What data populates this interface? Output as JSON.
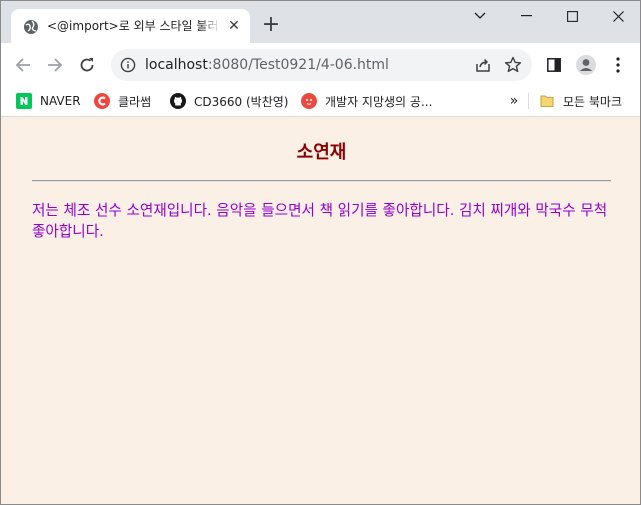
{
  "tab": {
    "title": "<@import>로 외부 스타일 불러",
    "close_glyph": "✕",
    "new_tab_glyph": "+"
  },
  "omnibox": {
    "host": "localhost",
    "path": ":8080/Test0921/4-06.html"
  },
  "bookmarks": {
    "items": [
      {
        "label": "NAVER",
        "icon": "naver-icon"
      },
      {
        "label": "클라썸",
        "icon": "classum-icon"
      },
      {
        "label": "CD3660 (박찬영)",
        "icon": "github-icon"
      },
      {
        "label": "개발자 지망생의 공...",
        "icon": "ghost-icon"
      }
    ],
    "more_glyph": "»",
    "all_bookmarks": "모든 북마크"
  },
  "page": {
    "heading": "소연재",
    "paragraph": "저는 체조 선수 소연재입니다. 음악을 들으면서 책 읽기를 좋아합니다. 김치 찌개와 막국수 무척 좋아합니다."
  },
  "colors": {
    "page_background": "#faf0e6",
    "heading": "#8b0000",
    "paragraph": "#9400d3"
  }
}
